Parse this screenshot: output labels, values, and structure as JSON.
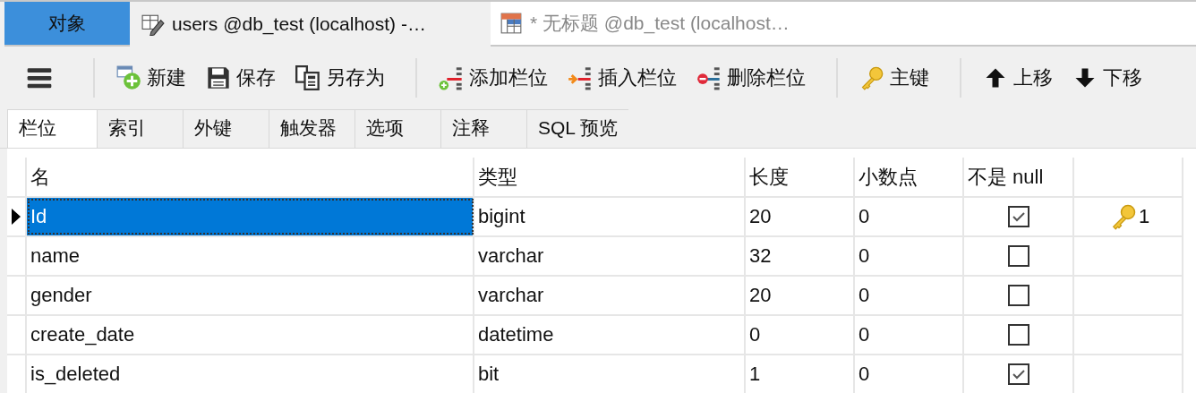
{
  "window_tabs": [
    {
      "kind": "objects",
      "label": "对象",
      "selected": false
    },
    {
      "kind": "designer",
      "label": "users @db_test (localhost) -…",
      "selected": true
    },
    {
      "kind": "query",
      "label": "* 无标题 @db_test (localhost…",
      "selected": false
    }
  ],
  "toolbar": [
    {
      "kind": "menu"
    },
    {
      "kind": "separator"
    },
    {
      "kind": "new",
      "label": "新建"
    },
    {
      "kind": "save",
      "label": "保存"
    },
    {
      "kind": "save_as",
      "label": "另存为"
    },
    {
      "kind": "separator"
    },
    {
      "kind": "add_field",
      "label": "添加栏位"
    },
    {
      "kind": "insert_field",
      "label": "插入栏位"
    },
    {
      "kind": "delete_field",
      "label": "删除栏位"
    },
    {
      "kind": "separator"
    },
    {
      "kind": "primary_key",
      "label": "主键"
    },
    {
      "kind": "separator"
    },
    {
      "kind": "move_up",
      "label": "上移"
    },
    {
      "kind": "move_down",
      "label": "下移"
    }
  ],
  "designer_tabs": [
    {
      "label": "栏位",
      "selected": true
    },
    {
      "label": "索引",
      "selected": false
    },
    {
      "label": "外键",
      "selected": false
    },
    {
      "label": "触发器",
      "selected": false
    },
    {
      "label": "选项",
      "selected": false
    },
    {
      "label": "注释",
      "selected": false
    },
    {
      "label": "SQL 预览",
      "selected": false
    }
  ],
  "fields_table": {
    "columns": [
      "名",
      "类型",
      "长度",
      "小数点",
      "不是 null"
    ],
    "rows": [
      {
        "name": "Id",
        "type": "bigint",
        "length": "20",
        "decimals": "0",
        "not_null": true,
        "primary_key": true,
        "key_order": "1",
        "selected": true
      },
      {
        "name": "name",
        "type": "varchar",
        "length": "32",
        "decimals": "0",
        "not_null": false,
        "primary_key": false,
        "selected": false
      },
      {
        "name": "gender",
        "type": "varchar",
        "length": "20",
        "decimals": "0",
        "not_null": false,
        "primary_key": false,
        "selected": false
      },
      {
        "name": "create_date",
        "type": "datetime",
        "length": "0",
        "decimals": "0",
        "not_null": false,
        "primary_key": false,
        "selected": false
      },
      {
        "name": "is_deleted",
        "type": "bit",
        "length": "1",
        "decimals": "0",
        "not_null": true,
        "primary_key": false,
        "selected": false
      }
    ]
  }
}
